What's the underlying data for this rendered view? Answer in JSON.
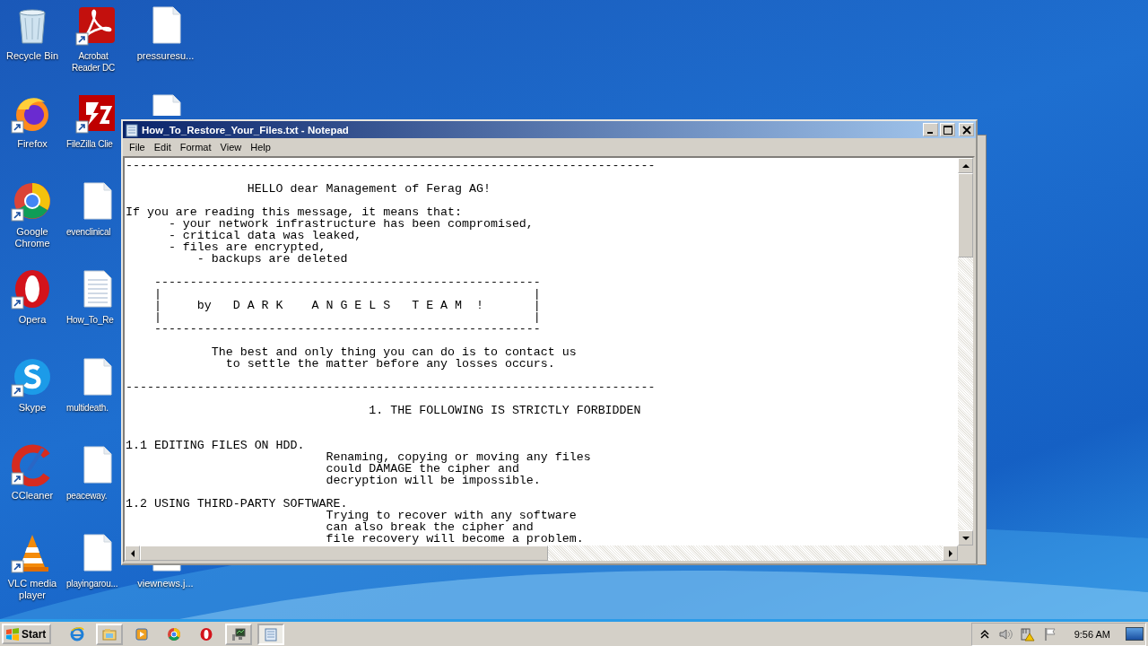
{
  "desktop_icons": [
    {
      "label": "Recycle Bin",
      "kind": "recycle",
      "shortcut": false
    },
    {
      "label": "Firefox",
      "kind": "firefox",
      "shortcut": true
    },
    {
      "label": "Google Chrome",
      "kind": "chrome",
      "shortcut": true
    },
    {
      "label": "Opera",
      "kind": "opera",
      "shortcut": true
    },
    {
      "label": "Skype",
      "kind": "skype",
      "shortcut": true
    },
    {
      "label": "CCleaner",
      "kind": "ccleaner",
      "shortcut": true
    },
    {
      "label": "VLC media player",
      "kind": "vlc",
      "shortcut": true
    },
    {
      "label": "Acrobat Reader DC",
      "kind": "acrobat",
      "shortcut": true
    },
    {
      "label": "FileZilla Clie",
      "kind": "filezilla",
      "shortcut": true
    },
    {
      "label": "evenclinical",
      "kind": "document",
      "shortcut": false
    },
    {
      "label": "How_To_Re",
      "kind": "textfile",
      "shortcut": false
    },
    {
      "label": "multideath.",
      "kind": "document",
      "shortcut": false
    },
    {
      "label": "peaceway.",
      "kind": "document",
      "shortcut": false
    },
    {
      "label": "playingarou...",
      "kind": "document",
      "shortcut": false
    },
    {
      "label": "pressuresu...",
      "kind": "document",
      "shortcut": false
    },
    {
      "kind": "document"
    },
    {
      "label": "viewnews.j...",
      "kind": "document",
      "shortcut": false
    }
  ],
  "notepad": {
    "title": "How_To_Restore_Your_Files.txt - Notepad",
    "menu": [
      "File",
      "Edit",
      "Format",
      "View",
      "Help"
    ],
    "lines": [
      {
        "kind": "line",
        "text": "--------------------------------------------------------------------------"
      },
      {
        "kind": "blank"
      },
      {
        "kind": "line",
        "text": "                 HELLO dear Management of Ferag AG!"
      },
      {
        "kind": "blank"
      },
      {
        "kind": "line",
        "text": "If you are reading this message, it means that:"
      },
      {
        "kind": "line",
        "text": "      - your network infrastructure has been compromised,"
      },
      {
        "kind": "line",
        "text": "      - critical data was leaked,"
      },
      {
        "kind": "line",
        "text": "      - files are encrypted,"
      },
      {
        "kind": "line",
        "text": "          - backups are deleted"
      },
      {
        "kind": "blank"
      },
      {
        "kind": "line",
        "text": "    ------------------------------------------------------"
      },
      {
        "kind": "line",
        "text": "    |                                                    |"
      },
      {
        "kind": "line",
        "text": "    |     by   D A R K    A N G E L S   T E A M  !       |"
      },
      {
        "kind": "line",
        "text": "    |                                                    |"
      },
      {
        "kind": "line",
        "text": "    ------------------------------------------------------"
      },
      {
        "kind": "blank"
      },
      {
        "kind": "line",
        "text": "            The best and only thing you can do is to contact us"
      },
      {
        "kind": "line",
        "text": "              to settle the matter before any losses occurs."
      },
      {
        "kind": "blank"
      },
      {
        "kind": "line",
        "text": "--------------------------------------------------------------------------"
      },
      {
        "kind": "blank"
      },
      {
        "kind": "line",
        "text": "                                  1. THE FOLLOWING IS STRICTLY FORBIDDEN"
      },
      {
        "kind": "blank"
      },
      {
        "kind": "blank"
      },
      {
        "kind": "line",
        "text": "1.1 EDITING FILES ON HDD."
      },
      {
        "kind": "line",
        "text": "                            Renaming, copying or moving any files"
      },
      {
        "kind": "line",
        "text": "                            could DAMAGE the cipher and"
      },
      {
        "kind": "line",
        "text": "                            decryption will be impossible."
      },
      {
        "kind": "blank"
      },
      {
        "kind": "line",
        "text": "1.2 USING THIRD-PARTY SOFTWARE."
      },
      {
        "kind": "line",
        "text": "                            Trying to recover with any software"
      },
      {
        "kind": "line",
        "text": "                            can also break the cipher and"
      },
      {
        "kind": "line",
        "text": "                            file recovery will become a problem."
      }
    ]
  },
  "taskbar": {
    "start": "Start",
    "items": [
      {
        "kind": "ie",
        "open": false,
        "selected": false
      },
      {
        "kind": "explorer",
        "open": true,
        "selected": false
      },
      {
        "kind": "media",
        "open": false,
        "selected": false
      },
      {
        "kind": "chrome",
        "open": false,
        "selected": false
      },
      {
        "kind": "opera",
        "open": false,
        "selected": false
      },
      {
        "kind": "monitor",
        "open": true,
        "selected": false
      },
      {
        "kind": "notepad",
        "open": true,
        "selected": true
      }
    ],
    "clock": "9:56 AM"
  }
}
